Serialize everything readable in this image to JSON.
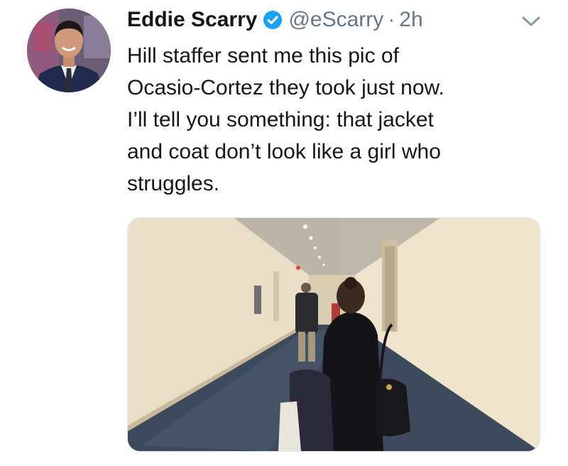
{
  "tweet": {
    "author": {
      "display_name": "Eddie Scarry",
      "handle": "@eScarry",
      "verified": true,
      "avatar_icon": "profile-photo"
    },
    "separator": "·",
    "timestamp": "2h",
    "text": "Hill staffer sent me this pic of\nOcasio-Cortez they took just now.\nI’ll tell you something: that jacket\nand coat don’t look like a girl who\nstruggles.",
    "menu_icon": "chevron-down-icon",
    "media": {
      "type": "photo"
    }
  },
  "colors": {
    "text": "#14171a",
    "secondary": "#657786",
    "verified_blue": "#1da1f2"
  }
}
